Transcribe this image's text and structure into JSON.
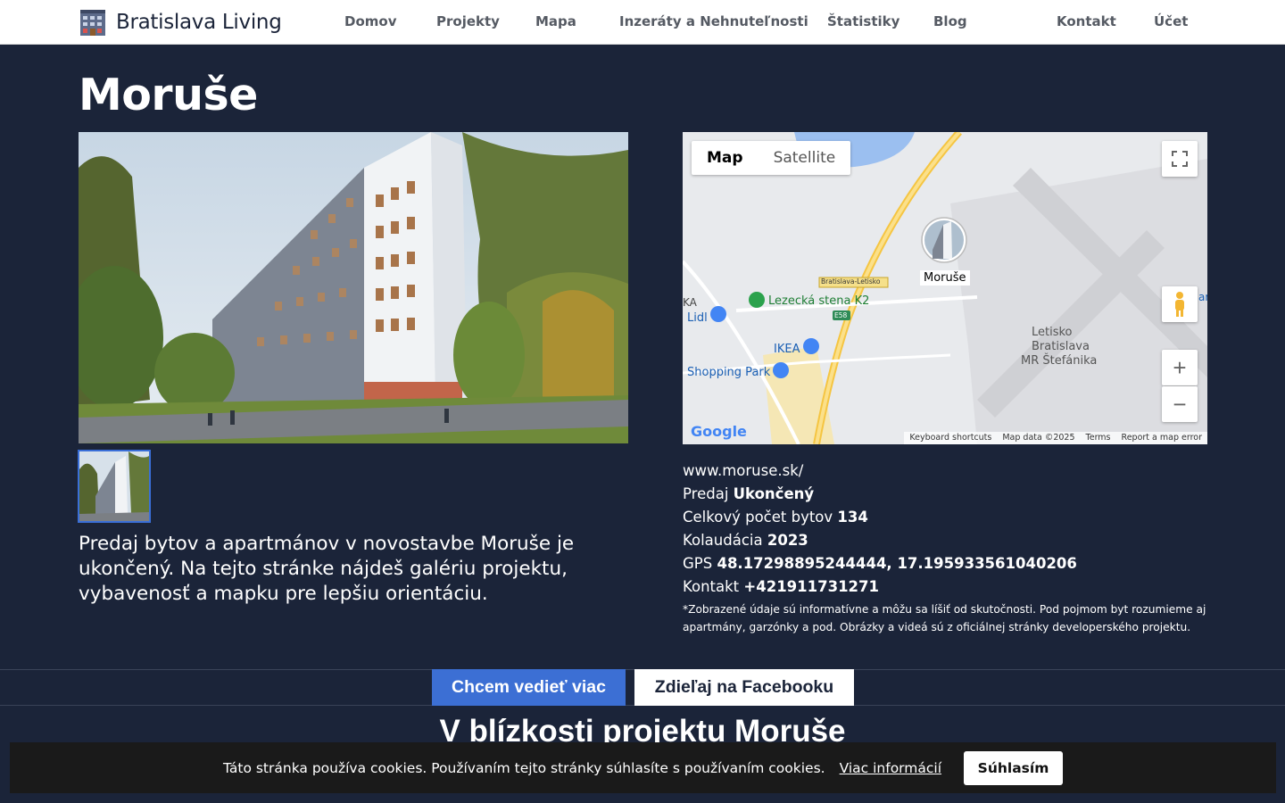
{
  "header": {
    "brand": "Bratislava Living",
    "nav": [
      {
        "label": "Domov"
      },
      {
        "label": "Projekty"
      },
      {
        "label": "Mapa"
      },
      {
        "label": "Inzeráty a Nehnuteľnosti"
      },
      {
        "label": "Štatistiky"
      },
      {
        "label": "Blog"
      },
      {
        "label": "Kontakt"
      },
      {
        "label": "Účet"
      }
    ]
  },
  "project": {
    "title": "Moruše",
    "description": "Predaj bytov a apartmánov v novostavbe Moruše je ukončený. Na tejto stránke nájdeš galériu projektu, vybavenosť a mapku pre lepšiu orientáciu."
  },
  "map": {
    "type_map": "Map",
    "type_satellite": "Satellite",
    "marker_label": "Moruše",
    "labels": {
      "lezecka": "Lezecká stena K2",
      "ikea": "IKEA",
      "lidl": "Lidl",
      "ka": "KA",
      "shopping": "Shopping Park",
      "airport_line1": "Letisko",
      "airport_line2": "Bratislava",
      "airport_line3": "MR Štefánika",
      "road_sign": "Bratislava-Letisko",
      "e58": "E58",
      "edge_partial": "ar"
    },
    "google": "Google",
    "footer": {
      "shortcuts": "Keyboard shortcuts",
      "data": "Map data ©2025",
      "terms": "Terms",
      "report": "Report a map error"
    }
  },
  "info": {
    "website": "www.moruse.sk/",
    "sale_label": "Predaj",
    "sale_value": "Ukončený",
    "units_label": "Celkový počet bytov",
    "units_value": "134",
    "completion_label": "Kolaudácia",
    "completion_value": "2023",
    "gps_label": "GPS",
    "gps_value": "48.17298895244444, 17.195933561040206",
    "contact_label": "Kontakt",
    "contact_value": "+421911731271",
    "disclaimer": "*Zobrazené údaje sú informatívne a môžu sa líšiť od skutočnosti. Pod pojmom byt rozumieme aj apartmány, garzónky a pod. Obrázky a videá sú z oficiálnej stránky developerského projektu."
  },
  "cta": {
    "primary": "Chcem vedieť viac",
    "secondary": "Zdieľaj na Facebooku"
  },
  "nearby": {
    "title": "V blízkosti projektu Moruše"
  },
  "cookie": {
    "text": "Táto stránka používa cookies. Používaním tejto stránky súhlasíte s používaním cookies.",
    "link": "Viac informácií",
    "accept": "Súhlasím"
  }
}
